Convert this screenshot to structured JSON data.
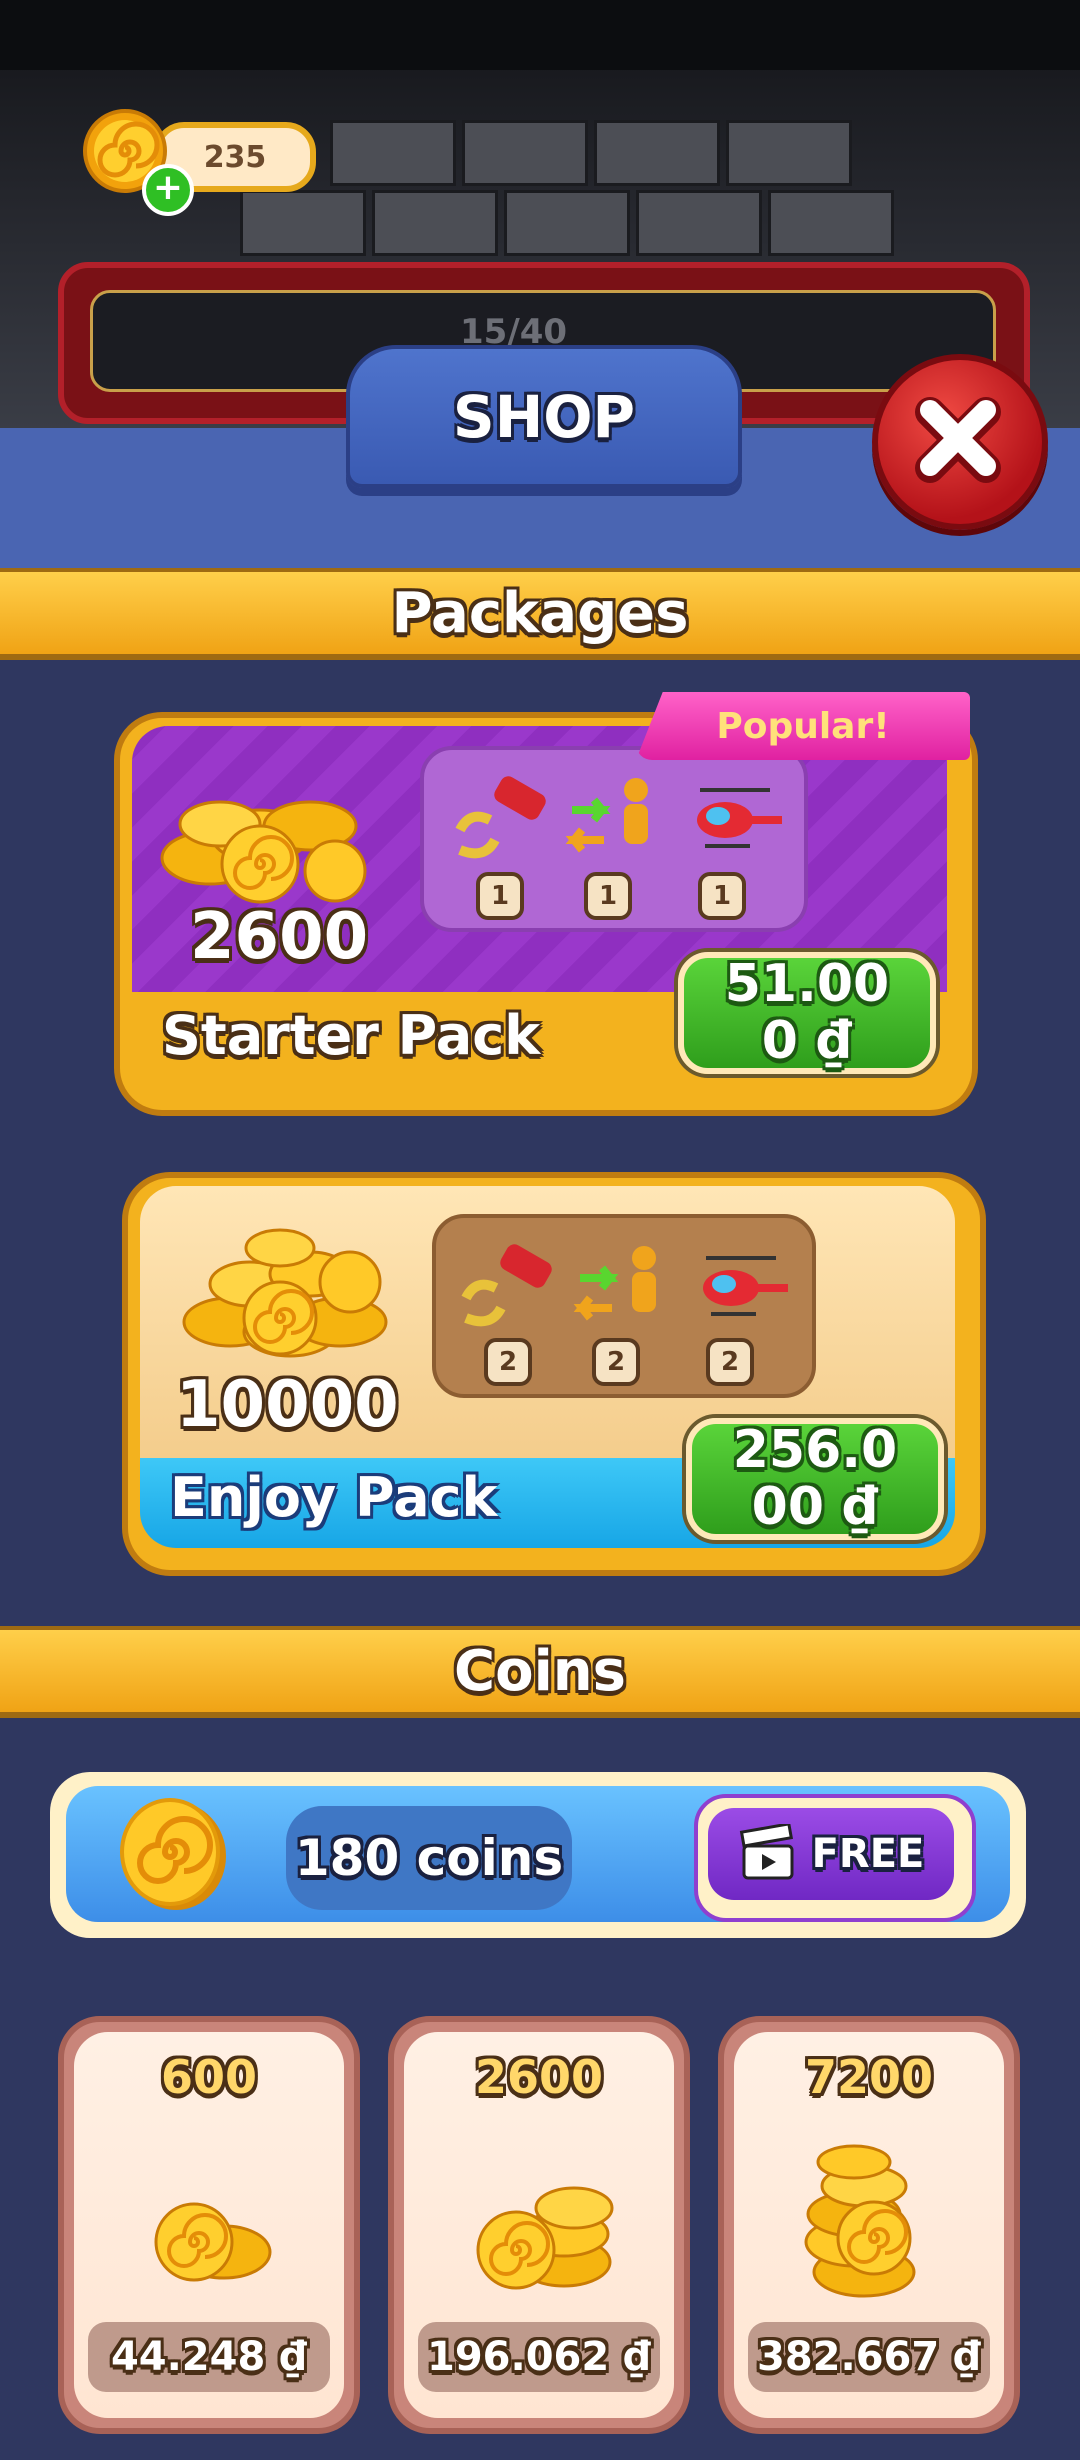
{
  "hud": {
    "coin_count": "235",
    "progress_text": "15/40"
  },
  "header": {
    "title": "SHOP"
  },
  "sections": {
    "packages_title": "Packages",
    "coins_title": "Coins"
  },
  "packages": [
    {
      "name": "Starter Pack",
      "coins": "2600",
      "ribbon": "Popular!",
      "items": [
        {
          "icon": "swap-car-icon",
          "count": "1"
        },
        {
          "icon": "swap-person-icon",
          "count": "1"
        },
        {
          "icon": "helicopter-icon",
          "count": "1"
        }
      ],
      "price_line1": "51.00",
      "price_line2": "0 ₫"
    },
    {
      "name": "Enjoy Pack",
      "coins": "10000",
      "items": [
        {
          "icon": "swap-car-icon",
          "count": "2"
        },
        {
          "icon": "swap-person-icon",
          "count": "2"
        },
        {
          "icon": "helicopter-icon",
          "count": "2"
        }
      ],
      "price_line1": "256.0",
      "price_line2": "00 ₫"
    }
  ],
  "free_offer": {
    "amount": "180 coins",
    "button_label": "FREE"
  },
  "coin_offers": [
    {
      "amount": "600",
      "price": "44.248 ₫"
    },
    {
      "amount": "2600",
      "price": "196.062 ₫"
    },
    {
      "amount": "7200",
      "price": "382.667 ₫"
    }
  ]
}
